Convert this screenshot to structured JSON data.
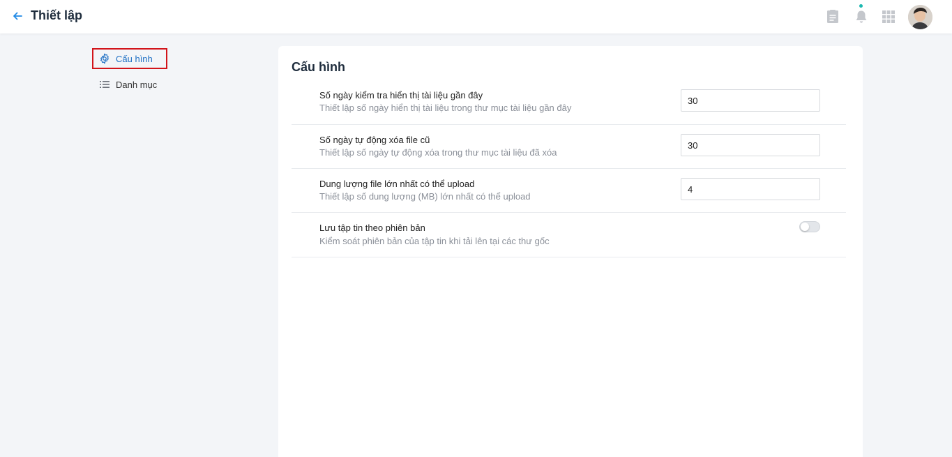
{
  "header": {
    "title": "Thiết lập",
    "back_icon": "arrow-left-icon",
    "icons": [
      "document-icon",
      "bell-icon",
      "apps-grid-icon"
    ],
    "accent_color": "#1e88e5",
    "notification_dot_color": "#1bb8b0"
  },
  "sidebar": {
    "items": [
      {
        "label": "Cấu hình",
        "icon": "gear-icon",
        "active": true
      },
      {
        "label": "Danh mục",
        "icon": "list-icon",
        "active": false
      }
    ],
    "active_color": "#1e6fc4",
    "highlight_border_color": "#d2141a"
  },
  "main": {
    "title": "Cấu hình",
    "settings": [
      {
        "label": "Số ngày kiểm tra hiển thị tài liệu gần đây",
        "description": "Thiết lập số ngày hiển thị tài liệu trong thư mục tài liệu gần đây",
        "value": "30"
      },
      {
        "label": "Số ngày tự động xóa file cũ",
        "description": "Thiết lập số ngày tự động xóa trong thư mục tài liệu đã xóa",
        "value": "30"
      },
      {
        "label": "Dung lượng file lớn nhất có thể upload",
        "description": "Thiết lập số dung lượng (MB) lớn nhất có thể upload",
        "value": "4"
      },
      {
        "label": "Lưu tập tin theo phiên bản",
        "description": "Kiểm soát phiên bản của tập tin khi tải lên tại các thư gốc",
        "toggle": false
      }
    ]
  }
}
